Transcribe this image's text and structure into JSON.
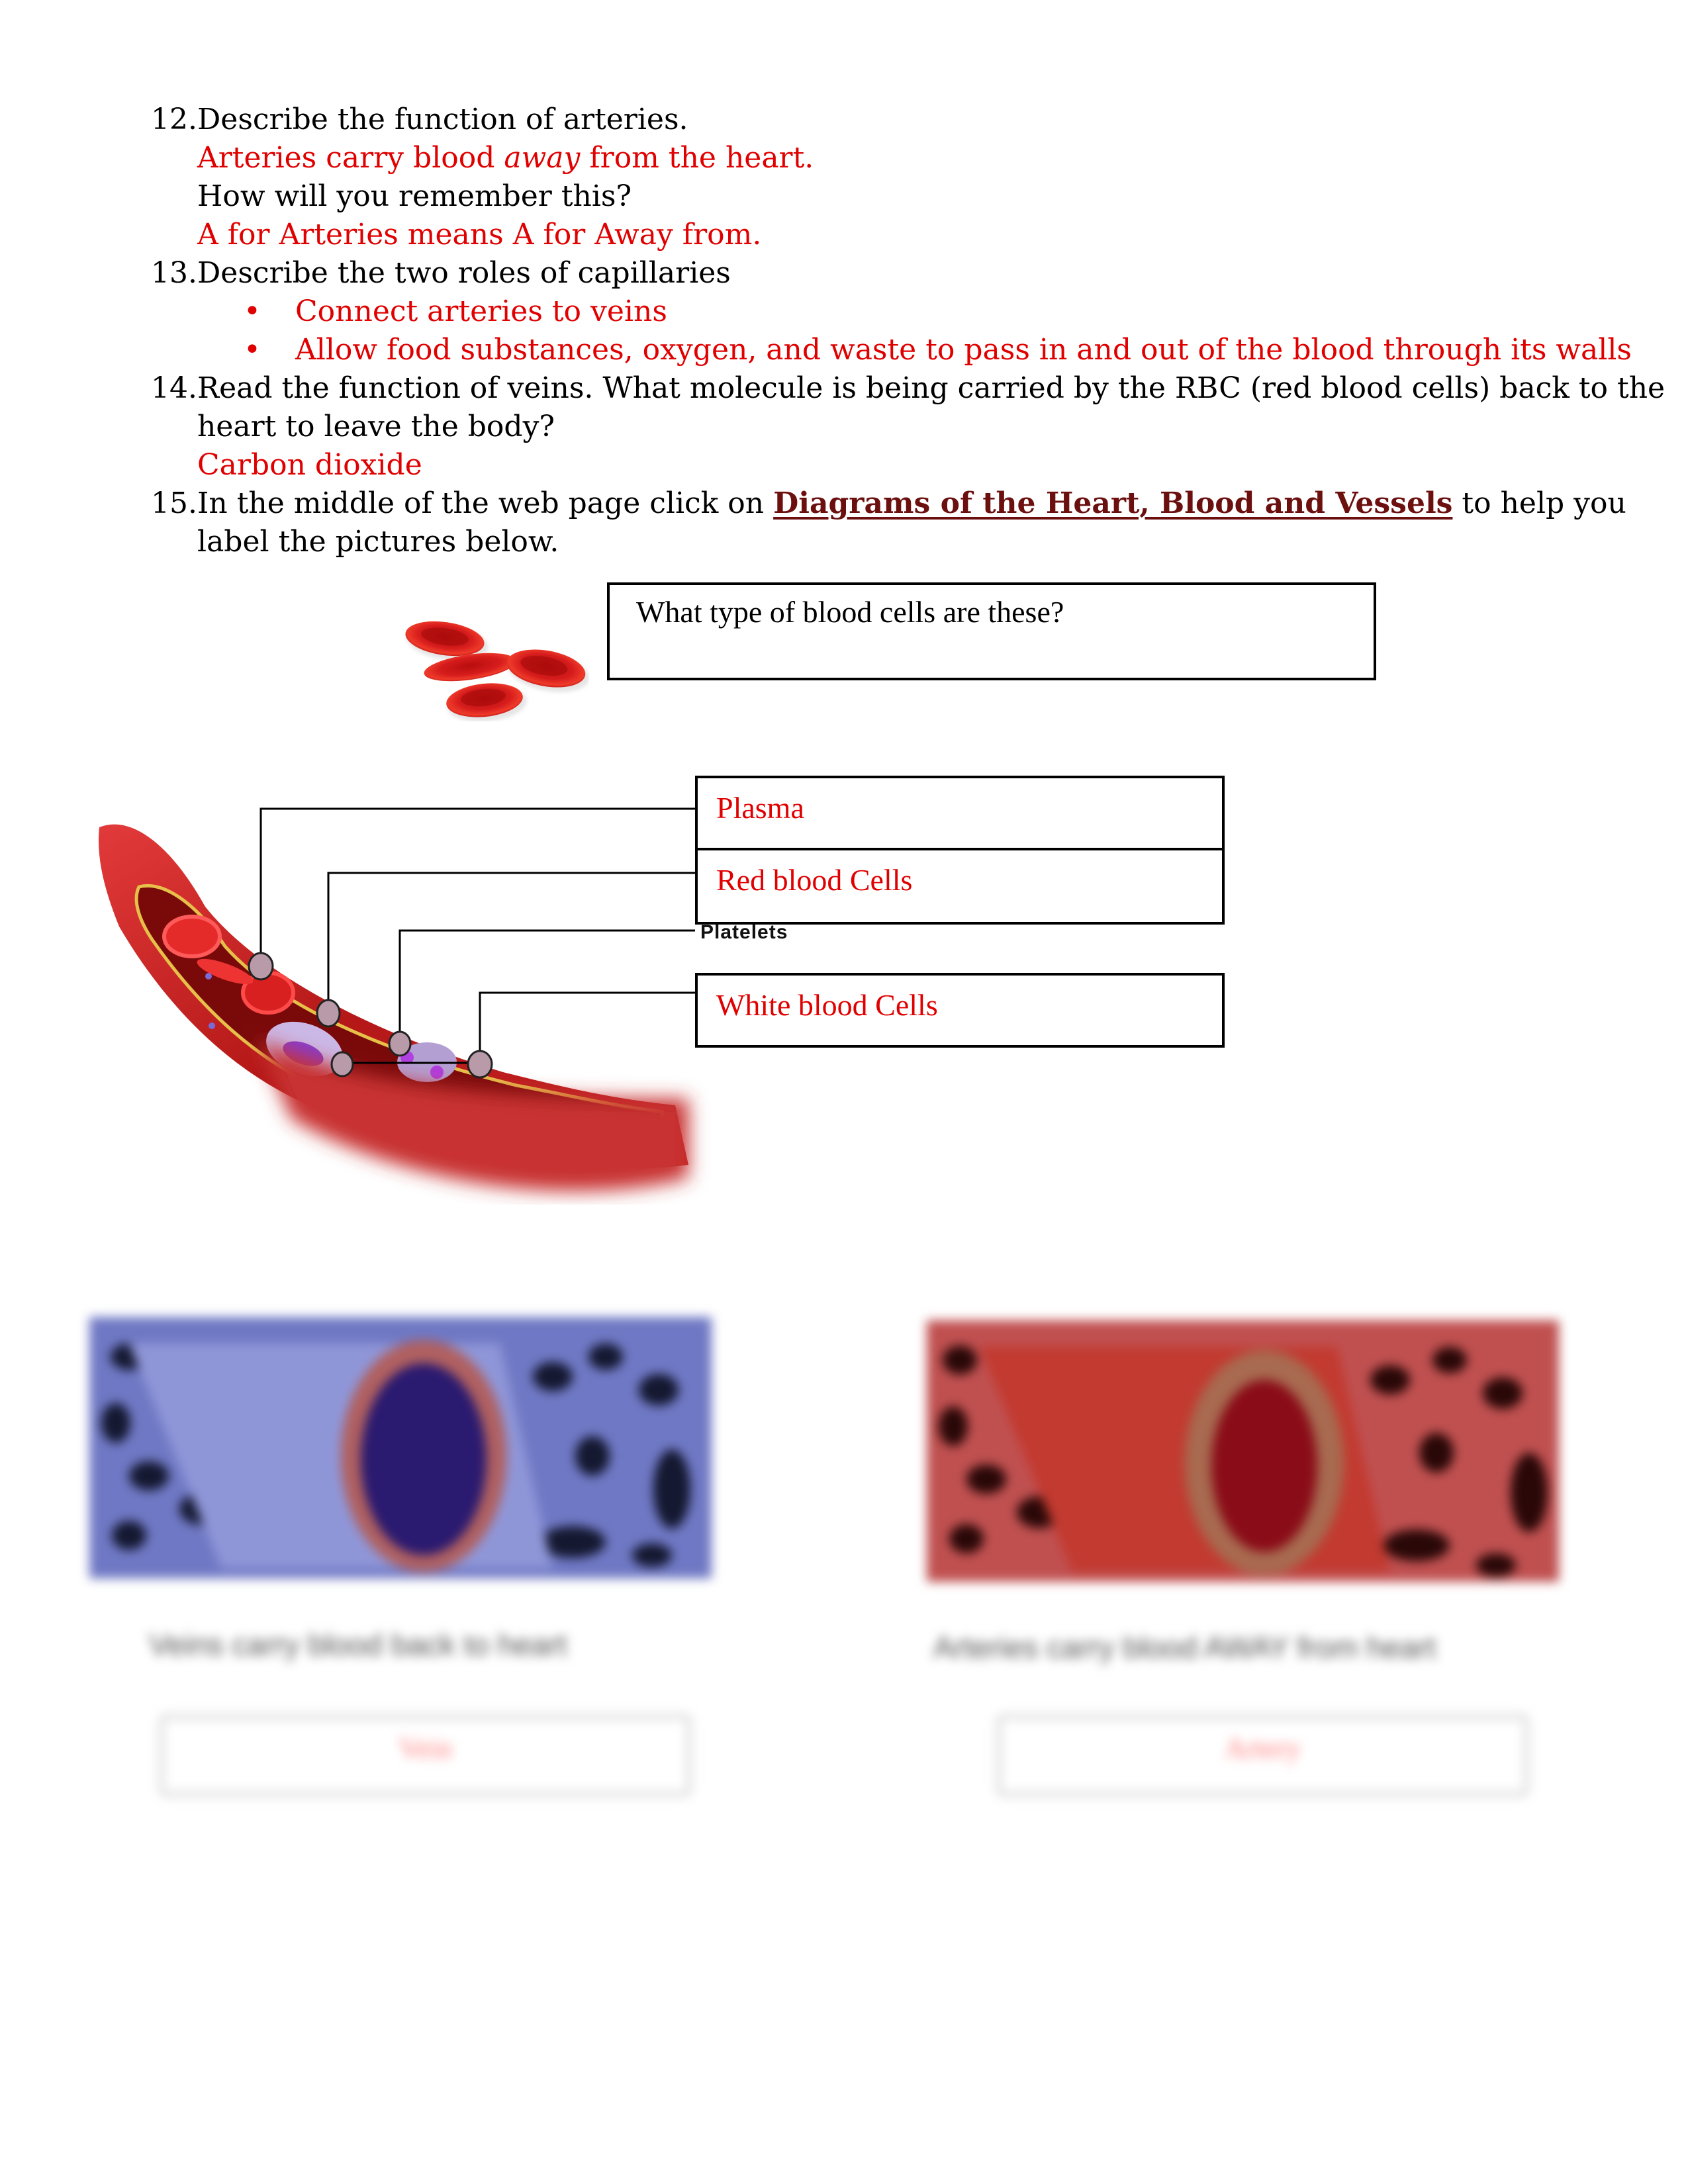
{
  "q12": {
    "number": "12.",
    "question": "Describe the function of arteries.",
    "answer_pre": "Arteries carry blood ",
    "answer_em": "away",
    "answer_post": " from the heart.",
    "followup": "How will you remember this?",
    "followup_answer": "A for Arteries means A for Away from."
  },
  "q13": {
    "number": "13.",
    "question": "Describe the two roles of capillaries",
    "bullets": [
      "Connect arteries to veins",
      "Allow food substances, oxygen, and waste to pass in and out of the blood through its walls"
    ],
    "bullet_glyph": "•"
  },
  "q14": {
    "number": "14.",
    "question_line1": "Read the function of veins. What molecule is being carried by the RBC (red blood cells) back to the",
    "question_line2": "heart to leave the body?",
    "answer": "Carbon dioxide"
  },
  "q15": {
    "number": "15.",
    "pre": "In the middle of the web page click on ",
    "link_text": "Diagrams of the Heart, Blood and Vessels",
    "post": " to help you",
    "line2": "label the pictures below."
  },
  "rbc_figure": {
    "question": "What type of blood cells are these?"
  },
  "vessel_diagram": {
    "labels": [
      "Plasma",
      "Red blood Cells",
      "Platelets",
      "White blood Cells"
    ]
  },
  "bottom_blurred": {
    "left_caption": "Veins carry blood back to heart",
    "left_answer": "Vein",
    "right_caption": "Arteries carry blood AWAY from heart",
    "right_answer": "Artery"
  },
  "colors": {
    "answer_red": "#e00000",
    "link": "#6b0f0f"
  }
}
